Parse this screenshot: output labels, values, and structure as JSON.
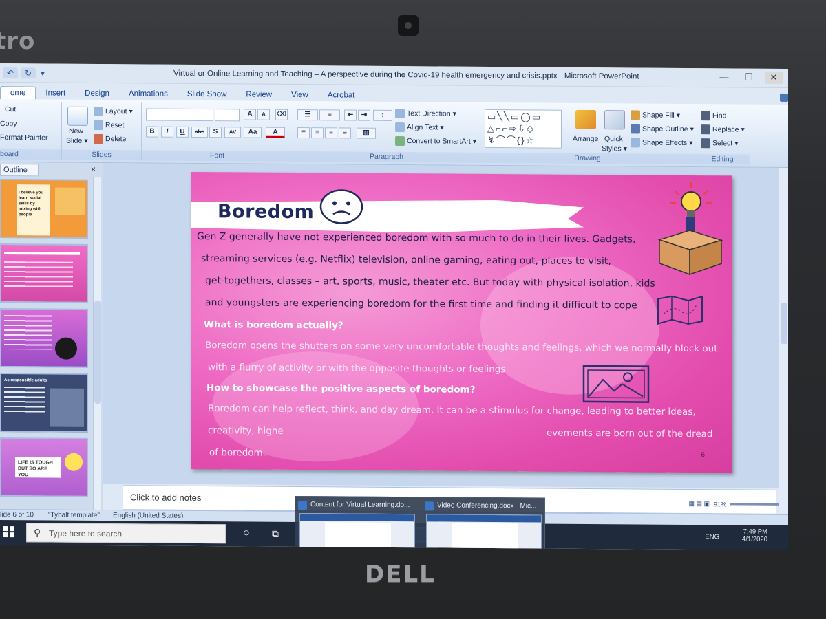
{
  "bezel": {
    "brand_top": "tro",
    "brand_bottom": "DELL"
  },
  "window": {
    "title": "Virtual or Online Learning and Teaching – A perspective during the Covid-19 health emergency and crisis.pptx - Microsoft PowerPoint"
  },
  "ribbon": {
    "tabs": [
      "ome",
      "Insert",
      "Design",
      "Animations",
      "Slide Show",
      "Review",
      "View",
      "Acrobat"
    ],
    "clipboard": {
      "cut": "Cut",
      "copy": "Copy",
      "format_painter": "Format Painter",
      "label": "board"
    },
    "slides": {
      "new_slide": "New",
      "new_slide2": "Slide",
      "layout": "Layout",
      "reset": "Reset",
      "delete": "Delete",
      "label": "Slides"
    },
    "font": {
      "grow": "A",
      "shrink": "A",
      "bold": "B",
      "italic": "I",
      "underline": "U",
      "strike": "abc",
      "shadow": "S",
      "spacing": "AV",
      "case": "Aa",
      "color": "A",
      "label": "Font"
    },
    "paragraph": {
      "text_direction": "Text Direction",
      "align_text": "Align Text",
      "smartart": "Convert to SmartArt",
      "label": "Paragraph"
    },
    "drawing": {
      "arrange": "Arrange",
      "quick_styles": "Quick",
      "quick_styles2": "Styles",
      "shape_fill": "Shape Fill",
      "shape_outline": "Shape Outline",
      "shape_effects": "Shape Effects",
      "label": "Drawing"
    },
    "editing": {
      "find": "Find",
      "replace": "Replace",
      "select": "Select",
      "label": "Editing"
    }
  },
  "pane": {
    "tab": "Outline",
    "close": "×",
    "thumbs": [
      {
        "text": "I believe you learn social skills by mixing with people"
      },
      {
        "text": ""
      },
      {
        "text": ""
      },
      {
        "text": "As responsible adults"
      },
      {
        "text": "LIFE IS TOUGH BUT SO ARE YOU"
      }
    ]
  },
  "slide": {
    "title": "Boredom",
    "lines": [
      "Gen Z generally have not experienced boredom with so much to do in their lives. Gadgets,",
      "streaming services (e.g. Netflix) television, online gaming, eating out, places to visit,",
      "get-togethers, classes – art, sports, music, theater etc. But today with physical isolation, kids",
      "and youngsters are experiencing boredom for the first time and finding it difficult to cope"
    ],
    "head1": "What is boredom actually?",
    "para1": [
      "Boredom opens the shutters on some very uncomfortable thoughts and feelings, which  we normally block out",
      "with a flurry of activity or with the opposite thoughts or feelings"
    ],
    "head2": "How to showcase the positive aspects of boredom?",
    "para2": [
      "Boredom can help reflect, think, and day dream. It can be a stimulus for change, leading to better ideas,",
      "creativity,  highe",
      "evements are born out of the dread",
      "of boredom."
    ],
    "number": "6"
  },
  "notes": {
    "placeholder": "Click to add notes"
  },
  "status": {
    "slide": "lide 6 of 10",
    "template": "\"Tybalt template\"",
    "language": "English (United States)",
    "zoom": "91%"
  },
  "taskbar": {
    "search": "Type here to search",
    "lang": "ENG",
    "time": "7:49 PM",
    "date": "4/1/2020",
    "previews": [
      {
        "title": "Content for Virtual Learning.do..."
      },
      {
        "title": "Video Conferencing.docx - Mic..."
      }
    ]
  },
  "colors": {
    "slide_pink": "#ee6bc4",
    "title_navy": "#1f2a5c",
    "ribbon_blue": "#dbe7f6"
  }
}
